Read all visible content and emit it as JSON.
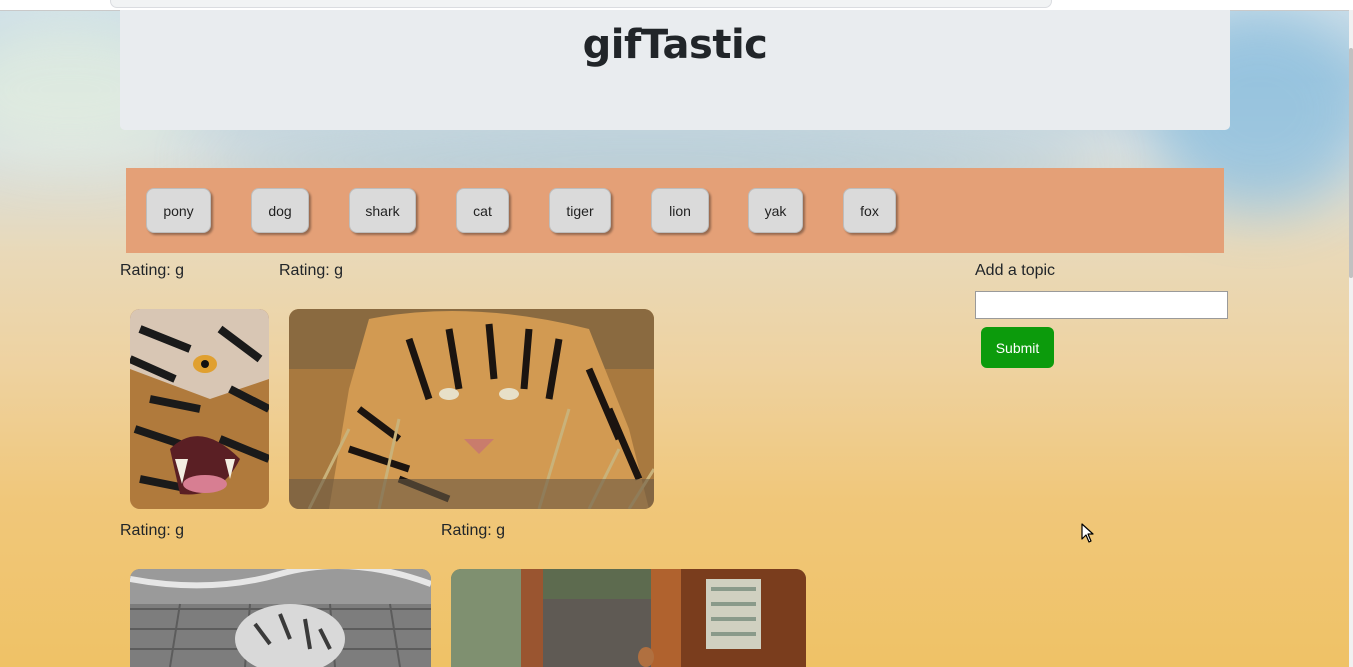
{
  "header": {
    "title": "gifTastic"
  },
  "topics": {
    "buttons": [
      "pony",
      "dog",
      "shark",
      "cat",
      "tiger",
      "lion",
      "yak",
      "fox"
    ]
  },
  "gifs": [
    {
      "rating": "Rating: g",
      "subject": "tiger"
    },
    {
      "rating": "Rating: g",
      "subject": "tiger"
    },
    {
      "rating": "Rating: g",
      "subject": "tiger"
    },
    {
      "rating": "Rating: g",
      "subject": "tiger"
    }
  ],
  "form": {
    "label": "Add a topic",
    "input_value": "",
    "submit_label": "Submit"
  },
  "colors": {
    "topic_bar": "#e4a077",
    "submit": "#0c9b0c",
    "jumbotron": "#e9ecef"
  }
}
